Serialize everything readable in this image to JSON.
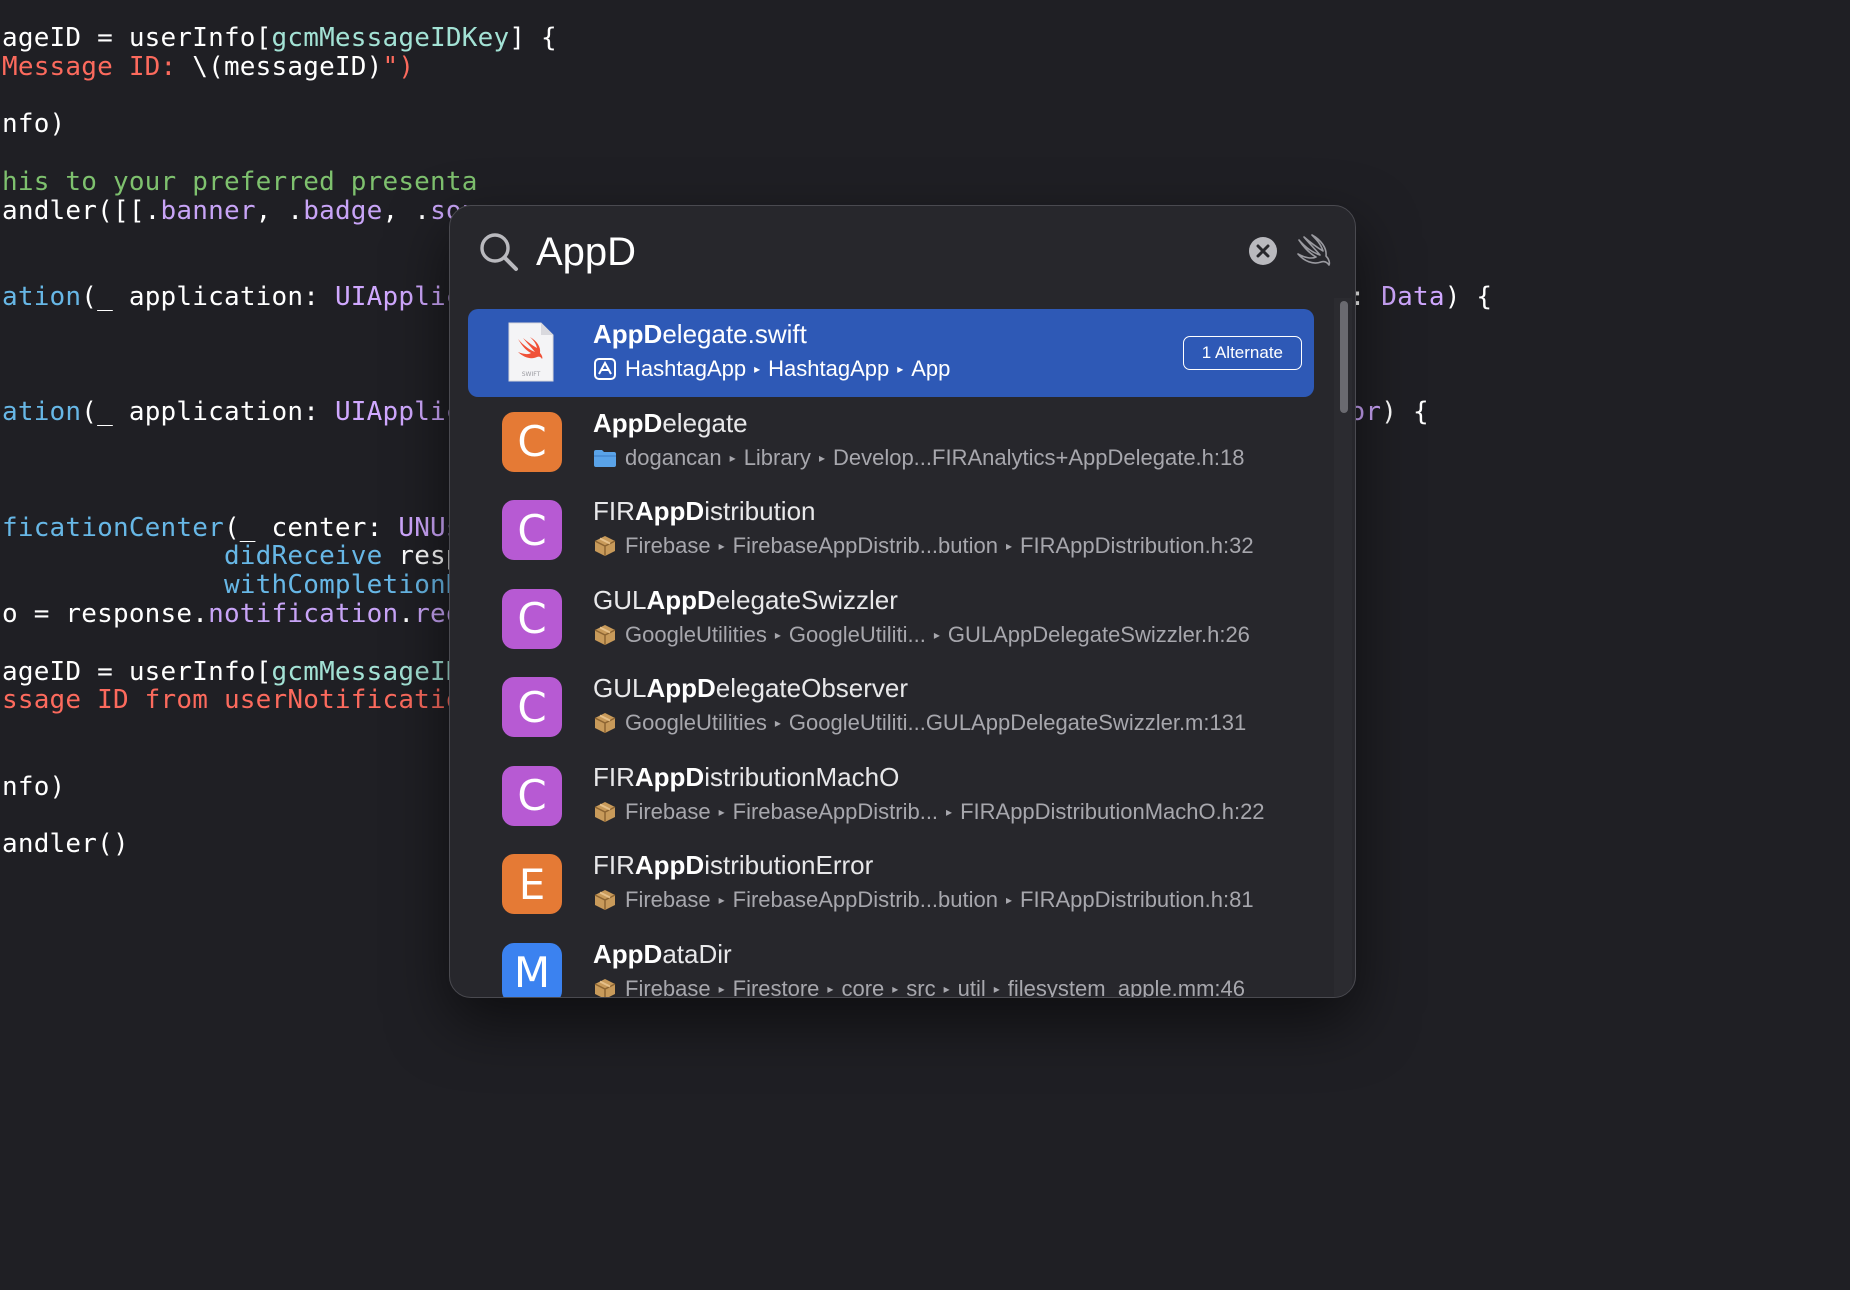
{
  "code": {
    "lines": [
      {
        "tokens": [
          {
            "t": "ageID = userInfo[",
            "c": "plain"
          },
          {
            "t": "gcmMessageIDKey",
            "c": "prop"
          },
          {
            "t": "] {",
            "c": "plain"
          }
        ]
      },
      {
        "tokens": [
          {
            "t": "Message ID: ",
            "c": "str"
          },
          {
            "t": "\\(messageID)",
            "c": "plain"
          },
          {
            "t": "\")",
            "c": "str"
          }
        ]
      },
      {
        "tokens": []
      },
      {
        "tokens": [
          {
            "t": "nfo)",
            "c": "plain"
          }
        ]
      },
      {
        "tokens": []
      },
      {
        "tokens": [
          {
            "t": "his to your preferred presenta",
            "c": "comment"
          }
        ]
      },
      {
        "tokens": [
          {
            "t": "andler([[.",
            "c": "plain"
          },
          {
            "t": "banner",
            "c": "member"
          },
          {
            "t": ", .",
            "c": "plain"
          },
          {
            "t": "badge",
            "c": "member"
          },
          {
            "t": ", .",
            "c": "plain"
          },
          {
            "t": "sou",
            "c": "member"
          }
        ]
      },
      {
        "tokens": []
      },
      {
        "tokens": []
      },
      {
        "tokens": [
          {
            "t": "ation",
            "c": "func"
          },
          {
            "t": "(_ application: ",
            "c": "plain"
          },
          {
            "t": "UIApplica",
            "c": "type"
          },
          {
            "t": "                                                  ",
            "c": "plain"
          },
          {
            "t": "Token: ",
            "c": "plain"
          },
          {
            "t": "Data",
            "c": "type"
          },
          {
            "t": ") {",
            "c": "plain"
          }
        ]
      },
      {
        "tokens": []
      },
      {
        "tokens": []
      },
      {
        "tokens": []
      },
      {
        "tokens": [
          {
            "t": "ation",
            "c": "func"
          },
          {
            "t": "(_ application: ",
            "c": "plain"
          },
          {
            "t": "UIApplica",
            "c": "type"
          },
          {
            "t": "                                                    ",
            "c": "plain"
          },
          {
            "t": "Error",
            "c": "type"
          },
          {
            "t": ") {",
            "c": "plain"
          }
        ]
      },
      {
        "tokens": []
      },
      {
        "tokens": []
      },
      {
        "tokens": []
      },
      {
        "tokens": [
          {
            "t": "ficationCenter",
            "c": "func"
          },
          {
            "t": "(_ center: ",
            "c": "plain"
          },
          {
            "t": "UNUse",
            "c": "type"
          }
        ]
      },
      {
        "tokens": [
          {
            "t": "              ",
            "c": "plain"
          },
          {
            "t": "didReceive",
            "c": "func"
          },
          {
            "t": " resp",
            "c": "plain"
          }
        ]
      },
      {
        "tokens": [
          {
            "t": "              ",
            "c": "plain"
          },
          {
            "t": "withCompletionH",
            "c": "func"
          }
        ]
      },
      {
        "tokens": [
          {
            "t": "o = response.",
            "c": "plain"
          },
          {
            "t": "notification",
            "c": "member"
          },
          {
            "t": ".",
            "c": "plain"
          },
          {
            "t": "requ",
            "c": "member"
          }
        ]
      },
      {
        "tokens": []
      },
      {
        "tokens": [
          {
            "t": "ageID = userInfo[",
            "c": "plain"
          },
          {
            "t": "gcmMessageIDK",
            "c": "prop"
          }
        ]
      },
      {
        "tokens": [
          {
            "t": "ssage ID from userNotification",
            "c": "str"
          }
        ]
      },
      {
        "tokens": []
      },
      {
        "tokens": []
      },
      {
        "tokens": [
          {
            "t": "nfo)",
            "c": "plain"
          }
        ]
      },
      {
        "tokens": []
      },
      {
        "tokens": [
          {
            "t": "andler()",
            "c": "plain"
          }
        ]
      }
    ]
  },
  "search": {
    "value": "AppD",
    "clear_icon": "clear-circle-icon",
    "mode_icon": "swift-bird-icon"
  },
  "results": [
    {
      "icon": "swift-file-icon",
      "kind": "",
      "kind_color": "",
      "title_bold": "AppD",
      "title_rest": "elegate.swift",
      "title_prefix": "",
      "path_icon": "app-target-icon",
      "path": [
        "HashtagApp",
        "HashtagApp",
        "App"
      ],
      "badge": "1 Alternate",
      "selected": true
    },
    {
      "icon": "class-icon",
      "kind": "C",
      "kind_color": "#e57a35",
      "title_prefix": "",
      "title_bold": "AppD",
      "title_rest": "elegate",
      "path_icon": "folder-icon",
      "path": [
        "dogancan",
        "Library",
        "Develop...FIRAnalytics+AppDelegate.h:18"
      ],
      "badge": "",
      "selected": false
    },
    {
      "icon": "class-icon",
      "kind": "C",
      "kind_color": "#b75ad3",
      "title_prefix": "FIR",
      "title_bold": "AppD",
      "title_rest": "istribution",
      "path_icon": "package-icon",
      "path": [
        "Firebase",
        "FirebaseAppDistrib...bution",
        "FIRAppDistribution.h:32"
      ],
      "badge": "",
      "selected": false
    },
    {
      "icon": "class-icon",
      "kind": "C",
      "kind_color": "#b75ad3",
      "title_prefix": "GUL",
      "title_bold": "AppD",
      "title_rest": "elegateSwizzler",
      "path_icon": "package-icon",
      "path": [
        "GoogleUtilities",
        "GoogleUtiliti...",
        "GULAppDelegateSwizzler.h:26"
      ],
      "badge": "",
      "selected": false
    },
    {
      "icon": "class-icon",
      "kind": "C",
      "kind_color": "#b75ad3",
      "title_prefix": "GUL",
      "title_bold": "AppD",
      "title_rest": "elegateObserver",
      "path_icon": "package-icon",
      "path": [
        "GoogleUtilities",
        "GoogleUtiliti...GULAppDelegateSwizzler.m:131"
      ],
      "badge": "",
      "selected": false
    },
    {
      "icon": "class-icon",
      "kind": "C",
      "kind_color": "#b75ad3",
      "title_prefix": "FIR",
      "title_bold": "AppD",
      "title_rest": "istributionMachO",
      "path_icon": "package-icon",
      "path": [
        "Firebase",
        "FirebaseAppDistrib...",
        "FIRAppDistributionMachO.h:22"
      ],
      "badge": "",
      "selected": false
    },
    {
      "icon": "enum-icon",
      "kind": "E",
      "kind_color": "#e57a35",
      "title_prefix": "FIR",
      "title_bold": "AppD",
      "title_rest": "istributionError",
      "path_icon": "package-icon",
      "path": [
        "Firebase",
        "FirebaseAppDistrib...bution",
        "FIRAppDistribution.h:81"
      ],
      "badge": "",
      "selected": false
    },
    {
      "icon": "method-icon",
      "kind": "M",
      "kind_color": "#3b82f0",
      "title_prefix": "",
      "title_bold": "AppD",
      "title_rest": "ataDir",
      "path_icon": "package-icon",
      "path": [
        "Firebase",
        "Firestore",
        "core",
        "src",
        "util",
        "filesystem_apple.mm:46"
      ],
      "badge": "",
      "selected": false
    }
  ],
  "colors": {
    "accent": "#2e59b6",
    "background": "#1f1f24",
    "panel": "#27272c"
  }
}
